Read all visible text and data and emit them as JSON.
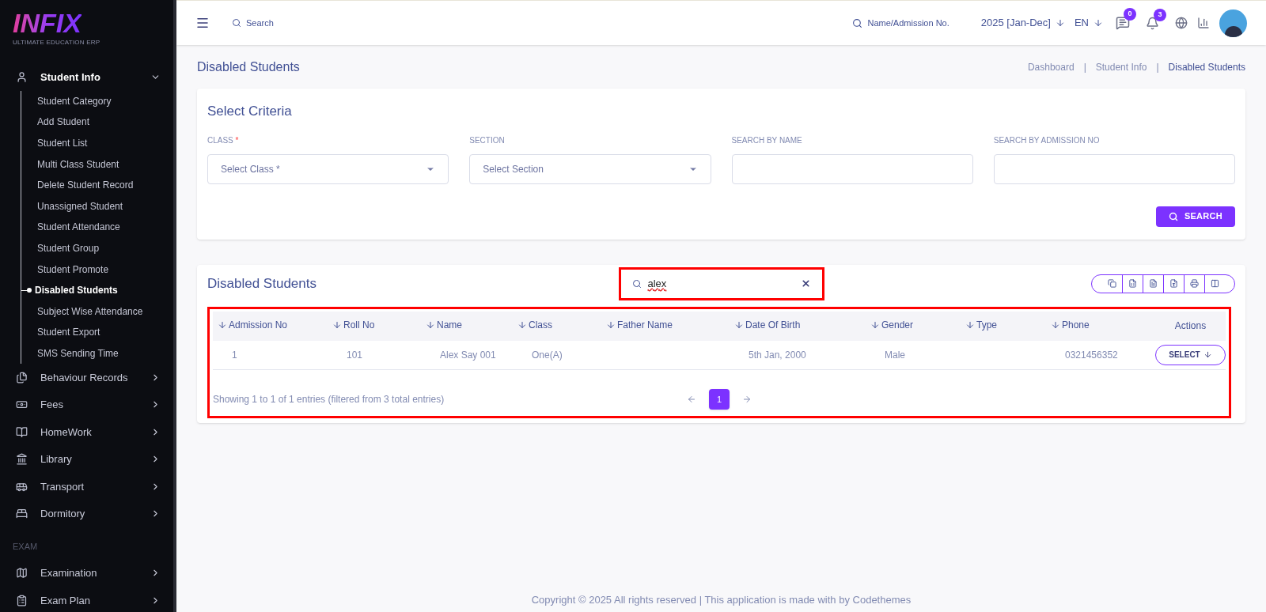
{
  "logo": {
    "text": "INFIX",
    "tagline": "ULTIMATE EDUCATION ERP"
  },
  "sidebar": {
    "sections": [
      {
        "items": [
          {
            "label": "Student Info",
            "expanded": true,
            "children": [
              {
                "label": "Student Category",
                "selected": false
              },
              {
                "label": "Add Student",
                "selected": false
              },
              {
                "label": "Student List",
                "selected": false
              },
              {
                "label": "Multi Class Student",
                "selected": false
              },
              {
                "label": "Delete Student Record",
                "selected": false
              },
              {
                "label": "Unassigned Student",
                "selected": false
              },
              {
                "label": "Student Attendance",
                "selected": false
              },
              {
                "label": "Student Group",
                "selected": false
              },
              {
                "label": "Student Promote",
                "selected": false
              },
              {
                "label": "Disabled Students",
                "selected": true
              },
              {
                "label": "Subject Wise Attendance",
                "selected": false
              },
              {
                "label": "Student Export",
                "selected": false
              },
              {
                "label": "SMS Sending Time",
                "selected": false
              }
            ]
          },
          {
            "label": "Behaviour Records",
            "expanded": false
          },
          {
            "label": "Fees",
            "expanded": false
          },
          {
            "label": "HomeWork",
            "expanded": false
          },
          {
            "label": "Library",
            "expanded": false
          },
          {
            "label": "Transport",
            "expanded": false
          },
          {
            "label": "Dormitory",
            "expanded": false
          }
        ]
      },
      {
        "heading": "EXAM",
        "items": [
          {
            "label": "Examination",
            "expanded": false
          },
          {
            "label": "Exam Plan",
            "expanded": false
          }
        ]
      }
    ]
  },
  "header": {
    "search_placeholder": "Search",
    "student_search": "Name/Admission No.",
    "session": "2025 [Jan-Dec]",
    "language": "EN",
    "message_count": "0",
    "notification_count": "3"
  },
  "page_title": "Disabled Students",
  "breadcrumb": [
    {
      "kind": "link",
      "label": "Dashboard"
    },
    {
      "kind": "separator",
      "label": "|"
    },
    {
      "kind": "link",
      "label": "Student Info"
    },
    {
      "kind": "separator",
      "label": "|"
    },
    {
      "kind": "current",
      "label": "Disabled Students"
    }
  ],
  "criteria": {
    "title": "Select Criteria",
    "fields": [
      {
        "kind": "select",
        "label": "CLASS",
        "required_mark": "*",
        "placeholder": "Select Class *"
      },
      {
        "kind": "select",
        "label": "SECTION",
        "placeholder": "Select Section"
      },
      {
        "kind": "text",
        "label": "SEARCH BY NAME"
      },
      {
        "kind": "text",
        "label": "SEARCH BY ADMISSION NO"
      }
    ],
    "button": "SEARCH"
  },
  "table_card": {
    "title": "Disabled Students",
    "search_value": "alex",
    "columns": [
      {
        "label": "Admission No",
        "sortable": true
      },
      {
        "label": "Roll No",
        "sortable": true
      },
      {
        "label": "Name",
        "sortable": true
      },
      {
        "label": "Class",
        "sortable": true
      },
      {
        "label": "Father Name",
        "sortable": true
      },
      {
        "label": "Date Of Birth",
        "sortable": true
      },
      {
        "label": "Gender",
        "sortable": true
      },
      {
        "label": "Type",
        "sortable": true
      },
      {
        "label": "Phone",
        "sortable": true
      },
      {
        "label": "Actions",
        "sortable": false
      }
    ],
    "rows": [
      {
        "cells": [
          "1",
          "101",
          "Alex Say 001",
          "One(A)",
          "",
          "5th Jan, 2000",
          "Male",
          "",
          "0321456352"
        ],
        "action": "SELECT"
      }
    ],
    "info": "Showing 1 to 1 of 1 entries (filtered from 3 total entries)",
    "pages": [
      {
        "label": "1",
        "selected": true
      }
    ]
  },
  "footer": "Copyright © 2025 All rights reserved | This application is made with by Codethemes"
}
